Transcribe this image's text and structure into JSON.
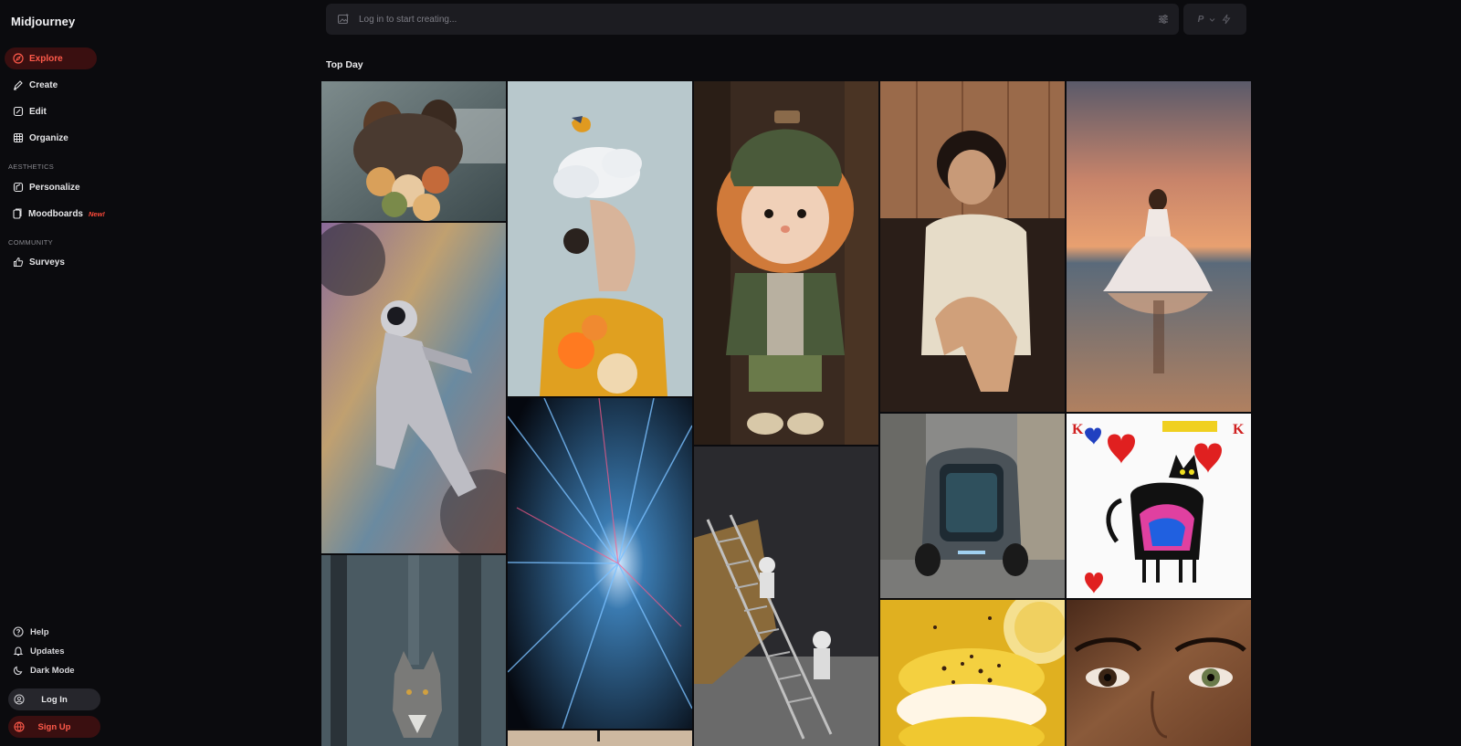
{
  "brand": "Midjourney",
  "nav": {
    "explore": "Explore",
    "create": "Create",
    "edit": "Edit",
    "organize": "Organize",
    "aesthetics_label": "AESTHETICS",
    "personalize": "Personalize",
    "moodboards": "Moodboards",
    "moodboards_badge": "New!",
    "community_label": "COMMUNITY",
    "surveys": "Surveys"
  },
  "footer": {
    "help": "Help",
    "updates": "Updates",
    "dark_mode": "Dark Mode",
    "login": "Log In",
    "signup": "Sign Up"
  },
  "prompt": {
    "placeholder": "Log in to start creating..."
  },
  "mode": {
    "label": "P"
  },
  "section_title": "Top Day",
  "colors": {
    "background": "#0b0b0e",
    "accent": "#ff5a4a",
    "accent_bg": "#3a0f10",
    "panel": "#1c1c21"
  },
  "gallery": [
    {
      "subject": "couple kissing with bouquet"
    },
    {
      "subject": "woman with cloud head and bird"
    },
    {
      "subject": "knit doll with beanie"
    },
    {
      "subject": "vintage portrait woman in armchair"
    },
    {
      "subject": "woman in white dress on beach at sunset"
    },
    {
      "subject": "astronaut floating in iridescent water"
    },
    {
      "subject": "light speed tunnel"
    },
    {
      "subject": "futuristic vehicle in alley"
    },
    {
      "subject": "king of hearts cat card"
    },
    {
      "subject": "astronauts on lunar lander ladder"
    },
    {
      "subject": "wolf in forest"
    },
    {
      "subject": "lemon macaron"
    },
    {
      "subject": "close up face portrait"
    }
  ]
}
